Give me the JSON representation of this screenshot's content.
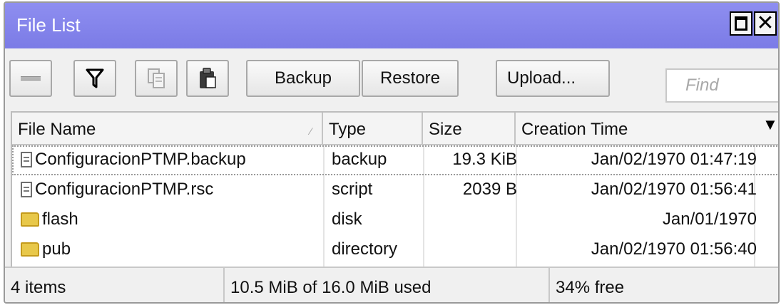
{
  "window": {
    "title": "File List"
  },
  "toolbar": {
    "backup_label": "Backup",
    "restore_label": "Restore",
    "upload_label": "Upload...",
    "find_placeholder": "Find"
  },
  "columns": [
    "File Name",
    "Type",
    "Size",
    "Creation Time"
  ],
  "files": [
    {
      "name": "ConfiguracionPTMP.backup",
      "type": "backup",
      "size": "19.3 KiB",
      "time": "Jan/02/1970 01:47:19",
      "icon": "document-icon"
    },
    {
      "name": "ConfiguracionPTMP.rsc",
      "type": "script",
      "size": "2039 B",
      "time": "Jan/02/1970 01:56:41",
      "icon": "document-icon"
    },
    {
      "name": "flash",
      "type": "disk",
      "size": "",
      "time": "Jan/01/1970",
      "icon": "folder-icon"
    },
    {
      "name": "pub",
      "type": "directory",
      "size": "",
      "time": "Jan/02/1970 01:56:40",
      "icon": "folder-icon"
    }
  ],
  "status": {
    "count": "4 items",
    "usage": "10.5 MiB of 16.0 MiB used",
    "free": "34% free"
  },
  "colors": {
    "titlebar": "#7b7be6",
    "folder": "#e8c84a"
  }
}
